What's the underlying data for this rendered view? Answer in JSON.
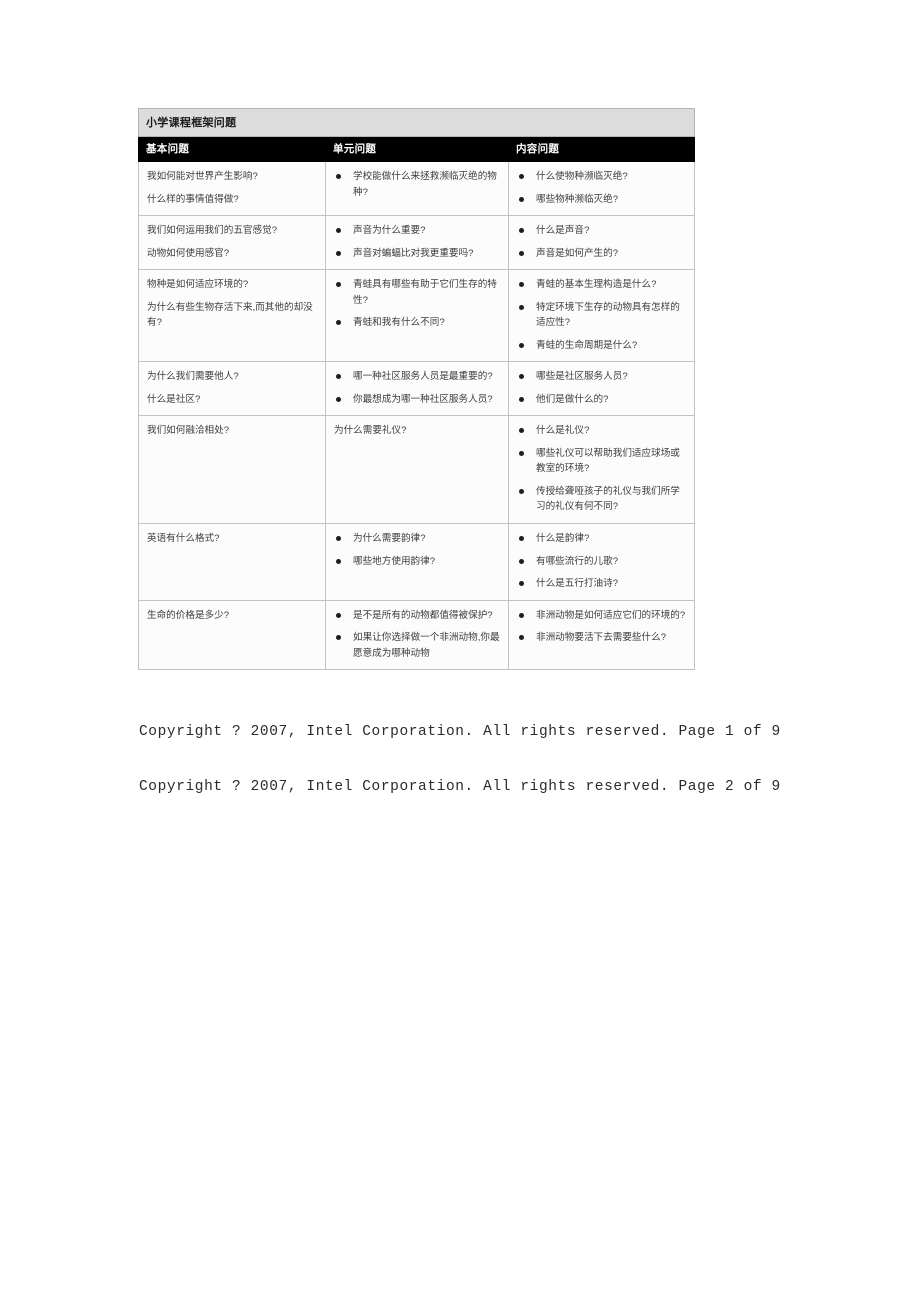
{
  "document": {
    "table": {
      "title": "小学课程框架问题",
      "columns": [
        {
          "key": "essential",
          "header": "基本问题"
        },
        {
          "key": "unit",
          "header": "单元问题"
        },
        {
          "key": "content",
          "header": "内容问题"
        }
      ],
      "rows": [
        {
          "essential": [
            "我如何能对世界产生影响?",
            "什么样的事情值得做?"
          ],
          "unit": [
            "学校能做什么来拯救濒临灭绝的物种?"
          ],
          "content": [
            "什么使物种濒临灭绝?",
            "哪些物种濒临灭绝?"
          ]
        },
        {
          "essential": [
            "我们如何运用我们的五官感觉?",
            "动物如何使用感官?"
          ],
          "unit": [
            "声音为什么重要?",
            "声音对蝙蝠比对我更重要吗?"
          ],
          "content": [
            "什么是声音?",
            "声音是如何产生的?"
          ]
        },
        {
          "essential": [
            "物种是如何适应环境的?",
            "为什么有些生物存活下来,而其他的却没有?"
          ],
          "unit": [
            "青蛙具有哪些有助于它们生存的特性?",
            "青蛙和我有什么不同?"
          ],
          "content": [
            "青蛙的基本生理构造是什么?",
            "特定环境下生存的动物具有怎样的适应性?",
            "青蛙的生命周期是什么?"
          ]
        },
        {
          "essential": [
            "为什么我们需要他人?",
            "什么是社区?"
          ],
          "unit": [
            "哪一种社区服务人员是最重要的?",
            "你最想成为哪一种社区服务人员?"
          ],
          "content": [
            "哪些是社区服务人员?",
            "他们是做什么的?"
          ]
        },
        {
          "essential": [
            "我们如何融洽相处?"
          ],
          "unit_plain": [
            "为什么需要礼仪?"
          ],
          "unit": [],
          "content": [
            "什么是礼仪?",
            "哪些礼仪可以帮助我们适应球场或教室的环境?",
            "传授给聋哑孩子的礼仪与我们所学习的礼仪有何不同?"
          ]
        },
        {
          "essential": [
            "英语有什么格式?"
          ],
          "unit": [
            "为什么需要韵律?",
            "哪些地方使用韵律?"
          ],
          "content": [
            "什么是韵律?",
            "有哪些流行的儿歌?",
            "什么是五行打油诗?"
          ]
        },
        {
          "essential": [
            "生命的价格是多少?"
          ],
          "unit": [
            "是不是所有的动物都值得被保护?",
            "如果让你选择做一个非洲动物,你最愿意成为哪种动物"
          ],
          "content": [
            "非洲动物是如何适应它们的环境的?",
            "非洲动物要活下去需要些什么?"
          ]
        }
      ]
    },
    "footers": [
      "Copyright ? 2007, Intel Corporation. All rights reserved. Page 1 of 9",
      "Copyright ? 2007, Intel Corporation. All rights reserved. Page 2 of 9"
    ]
  },
  "colors": {
    "title_band": "#dcdcdc",
    "header_band": "#000000",
    "header_text": "#ffffff",
    "body_text": "#3d3d3d",
    "grid_line": "#c2c2c2",
    "page_background": "#ffffff"
  }
}
